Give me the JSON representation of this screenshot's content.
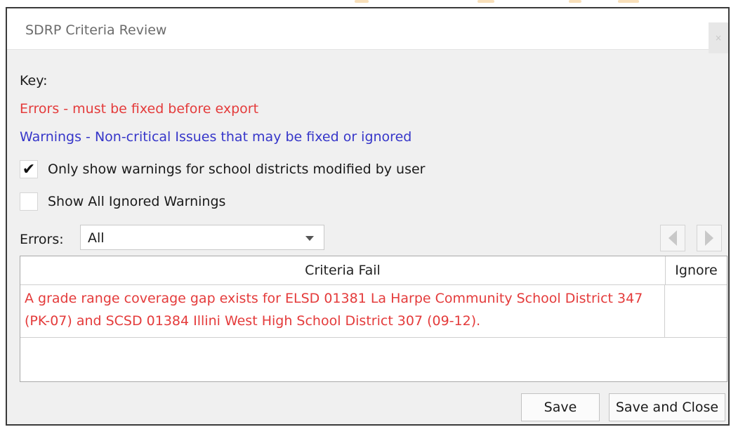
{
  "dialog": {
    "title": "SDRP Criteria Review",
    "close_label": "×"
  },
  "key": {
    "heading": "Key:",
    "errors_text": "Errors - must be fixed before export",
    "warnings_text": "Warnings - Non-critical Issues that may be fixed or ignored"
  },
  "options": {
    "only_modified": {
      "label": "Only show warnings for school districts modified by user",
      "checked": true,
      "mark": "✔"
    },
    "show_ignored": {
      "label": "Show All Ignored Warnings",
      "checked": false
    }
  },
  "filter": {
    "label": "Errors:",
    "selected": "All"
  },
  "nav": {
    "prev_icon": "triangle-left-icon",
    "next_icon": "triangle-right-icon"
  },
  "table": {
    "columns": [
      "Criteria Fail",
      "Ignore"
    ],
    "rows": [
      {
        "criteria": "A grade range coverage gap exists for ELSD 01381 La Harpe Community School District 347 (PK-07) and SCSD 01384 Illini West High School District 307 (09-12).",
        "ignore": ""
      }
    ]
  },
  "buttons": {
    "save": "Save",
    "save_and_close": "Save and Close"
  },
  "colors": {
    "error": "#e43b3b",
    "warning": "#3636c9"
  }
}
